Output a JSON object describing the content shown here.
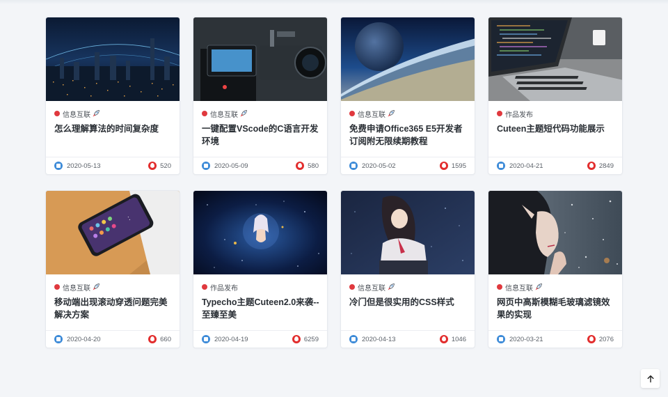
{
  "posts": [
    {
      "category": "信息互联",
      "rocket": true,
      "title": "怎么理解算法的时间复杂度",
      "date": "2020-05-13",
      "views": "520",
      "image": "city-night-skyline"
    },
    {
      "category": "信息互联",
      "rocket": true,
      "title": "一键配置VScode的C语言开发环境",
      "date": "2020-05-09",
      "views": "580",
      "image": "video-camera"
    },
    {
      "category": "信息互联",
      "rocket": true,
      "title": "免费申请Office365 E5开发者订阅附无限续期教程",
      "date": "2020-05-02",
      "views": "1595",
      "image": "planet-horizon"
    },
    {
      "category": "作品发布",
      "rocket": false,
      "title": "Cuteen主题短代码功能展示",
      "date": "2020-04-21",
      "views": "2849",
      "image": "laptop-code"
    },
    {
      "category": "信息互联",
      "rocket": true,
      "title": "移动端出现滚动穿透问题完美解决方案",
      "date": "2020-04-20",
      "views": "660",
      "image": "smartphone"
    },
    {
      "category": "作品发布",
      "rocket": false,
      "title": "Typecho主题Cuteen2.0来袭--至臻至美",
      "date": "2020-04-19",
      "views": "6259",
      "image": "anime-space-girl"
    },
    {
      "category": "信息互联",
      "rocket": true,
      "title": "冷门但是很实用的CSS样式",
      "date": "2020-04-13",
      "views": "1046",
      "image": "anime-girl-starry"
    },
    {
      "category": "信息互联",
      "rocket": true,
      "title": "网页中高斯模糊毛玻璃滤镜效果的实现",
      "date": "2020-03-21",
      "views": "2076",
      "image": "elf-girl-snow"
    }
  ],
  "icons": {
    "date": "calendar-icon",
    "views": "fire-icon",
    "rocket": "rocket-icon",
    "back_to_top": "arrow-up-icon"
  },
  "colors": {
    "category_dot": "#e0393e",
    "date_icon": "#3d8bd8",
    "views_icon": "#e22d2d",
    "page_background": "#f3f5f8"
  }
}
